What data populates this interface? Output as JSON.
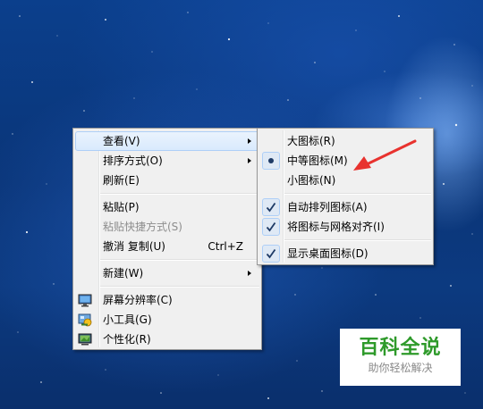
{
  "context_menu": {
    "items": [
      {
        "label": "查看(V)"
      },
      {
        "label": "排序方式(O)"
      },
      {
        "label": "刷新(E)"
      },
      {
        "label": "粘贴(P)"
      },
      {
        "label": "粘贴快捷方式(S)"
      },
      {
        "label": "撤消 复制(U)",
        "shortcut": "Ctrl+Z"
      },
      {
        "label": "新建(W)"
      },
      {
        "label": "屏幕分辨率(C)",
        "icon": "monitor-icon"
      },
      {
        "label": "小工具(G)",
        "icon": "gadgets-icon"
      },
      {
        "label": "个性化(R)",
        "icon": "personalize-icon"
      }
    ]
  },
  "view_submenu": {
    "items": [
      {
        "label": "大图标(R)"
      },
      {
        "label": "中等图标(M)",
        "selected_mark": "radio-dot-icon"
      },
      {
        "label": "小图标(N)"
      },
      {
        "label": "自动排列图标(A)",
        "selected_mark": "checkmark-icon"
      },
      {
        "label": "将图标与网格对齐(I)",
        "selected_mark": "checkmark-icon"
      },
      {
        "label": "显示桌面图标(D)",
        "selected_mark": "checkmark-icon"
      }
    ]
  },
  "watermark": {
    "title": "百科全说",
    "subtitle": "助你轻松解决"
  },
  "colors": {
    "desktop_background": "#0b3f8c",
    "menu_background": "#f0f0f0",
    "highlight": "#d9eafd",
    "annotation_arrow": "#e8322e",
    "watermark_text": "#2e9a2a"
  }
}
